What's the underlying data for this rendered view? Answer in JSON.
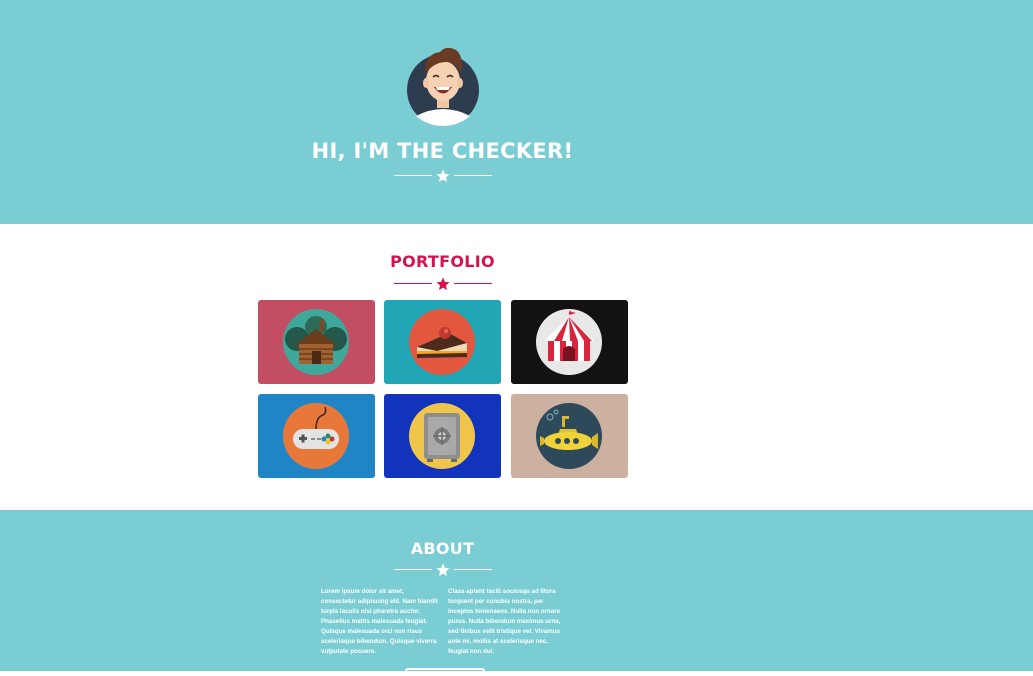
{
  "hero": {
    "title": "HI, I'M THE CHECKER!",
    "avatar_icon": "person-avatar-icon",
    "divider_icon": "star-icon",
    "background_color": "#7acdd3"
  },
  "portfolio": {
    "title": "PORTFOLIO",
    "accent_color": "#d4124e",
    "items": [
      {
        "icon": "cabin-icon",
        "background_color": "#c34d63"
      },
      {
        "icon": "cake-slice-icon",
        "background_color": "#21a6b5"
      },
      {
        "icon": "circus-tent-icon",
        "background_color": "#131111"
      },
      {
        "icon": "game-controller-icon",
        "background_color": "#1f85c4"
      },
      {
        "icon": "safe-icon",
        "background_color": "#1234bd"
      },
      {
        "icon": "submarine-icon",
        "background_color": "#cdb1a0"
      }
    ]
  },
  "about": {
    "title": "ABOUT",
    "column_left": "Lorem ipsum dolor sit amet, consectetur adipiscing elit. Nam blandit turpis iaculis nisl pharetra auctor. Phasellus mattis malesuada feugiat. Quisque malesuada orci non risus scelerisque bibendum. Quisque viverra vulputate posuere.",
    "column_right": "Class aptent taciti sociosqu ad litora torquent per conubia nostra, per inceptos himenaeos. Nulla non ornare purus. Nulla bibendum maximus urna, sed finibus velit tristique vel. Vivamus ante mi, mollis at scelerisque nec, feugiat non dui."
  }
}
